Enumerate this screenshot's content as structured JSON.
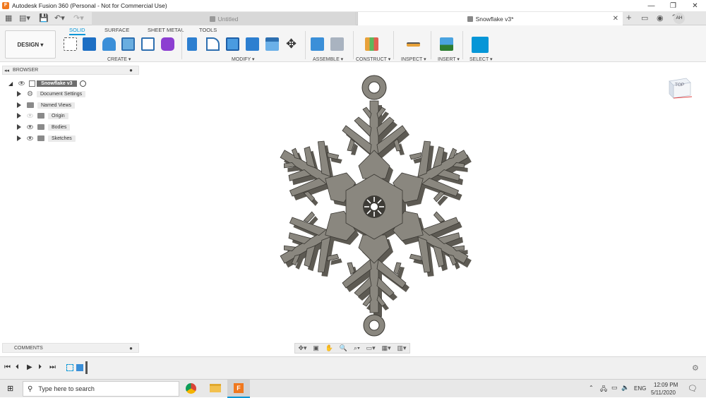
{
  "window": {
    "title": "Autodesk Fusion 360 (Personal - Not for Commercial Use)",
    "app_icon_letter": "F"
  },
  "tabs": [
    {
      "label": "Untitled",
      "active": false
    },
    {
      "label": "Snowflake v3*",
      "active": true
    }
  ],
  "user": {
    "initials": "AH"
  },
  "ribbon": {
    "workspace": "DESIGN ▾",
    "tabs": [
      "SOLID",
      "SURFACE",
      "SHEET METAL",
      "TOOLS"
    ],
    "active_tab": "SOLID",
    "groups": [
      "CREATE ▾",
      "MODIFY ▾",
      "ASSEMBLE ▾",
      "CONSTRUCT ▾",
      "INSPECT ▾",
      "INSERT ▾",
      "SELECT ▾"
    ],
    "accent": "#0696d7"
  },
  "browser": {
    "header": "BROWSER",
    "root": "Snowflake v3",
    "items": [
      "Document Settings",
      "Named Views",
      "Origin",
      "Bodies",
      "Sketches"
    ]
  },
  "comments": {
    "label": "COMMENTS"
  },
  "viewcube": {
    "face": "TOP"
  },
  "taskbar": {
    "search_placeholder": "Type here to search",
    "language": "ENG",
    "time": "12:09 PM",
    "date": "5/11/2020"
  },
  "colors": {
    "model": "#8a877f",
    "model_side": "#5d5a53",
    "model_edge": "#3a3833"
  }
}
